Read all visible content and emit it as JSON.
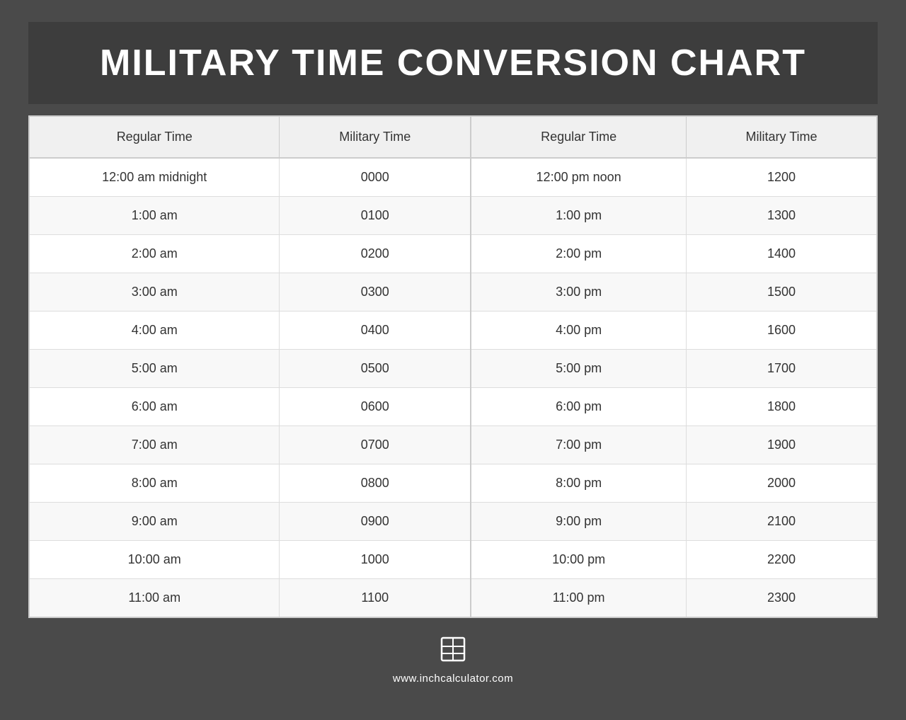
{
  "page": {
    "background_color": "#4a4a4a",
    "title": "MILITARY TIME CONVERSION CHART",
    "website": "www.inchcalculator.com"
  },
  "table": {
    "headers": [
      "Regular Time",
      "Military Time",
      "Regular Time",
      "Military Time"
    ],
    "rows": [
      [
        "12:00 am midnight",
        "0000",
        "12:00 pm noon",
        "1200"
      ],
      [
        "1:00 am",
        "0100",
        "1:00 pm",
        "1300"
      ],
      [
        "2:00 am",
        "0200",
        "2:00 pm",
        "1400"
      ],
      [
        "3:00 am",
        "0300",
        "3:00 pm",
        "1500"
      ],
      [
        "4:00 am",
        "0400",
        "4:00 pm",
        "1600"
      ],
      [
        "5:00 am",
        "0500",
        "5:00 pm",
        "1700"
      ],
      [
        "6:00 am",
        "0600",
        "6:00 pm",
        "1800"
      ],
      [
        "7:00 am",
        "0700",
        "7:00 pm",
        "1900"
      ],
      [
        "8:00 am",
        "0800",
        "8:00 pm",
        "2000"
      ],
      [
        "9:00 am",
        "0900",
        "9:00 pm",
        "2100"
      ],
      [
        "10:00 am",
        "1000",
        "10:00 pm",
        "2200"
      ],
      [
        "11:00 am",
        "1100",
        "11:00 pm",
        "2300"
      ]
    ]
  }
}
